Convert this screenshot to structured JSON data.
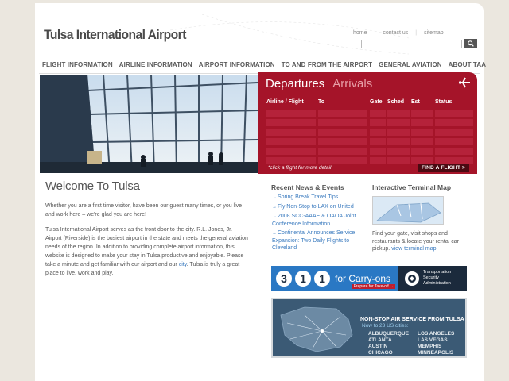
{
  "header": {
    "logo": "Tulsa International Airport",
    "util_links": [
      "home",
      "contact us",
      "sitemap"
    ]
  },
  "nav": {
    "items": [
      "FLIGHT INFORMATION",
      "AIRLINE INFORMATION",
      "AIRPORT INFORMATION",
      "TO AND FROM THE AIRPORT",
      "GENERAL AVIATION",
      "ABOUT TAA"
    ]
  },
  "board": {
    "tab_active": "Departures",
    "tab_inactive": "Arrivals",
    "columns": [
      "Airline / Flight",
      "To",
      "Gate",
      "Sched",
      "Est",
      "Status"
    ],
    "hint": "*click a flight for more detail",
    "find_button": "FIND A FLIGHT >"
  },
  "welcome": {
    "title": "Welcome To Tulsa",
    "para1": "Whether you are a first time visitor, have been our guest many times, or you live and work here – we're glad you are here!",
    "para2_a": "Tulsa International Airport serves as the front door to the city. R.L. Jones, Jr. Airport (Riverside) is the busiest airport in the state and meets the general aviation needs of the region. In addition to providing complete airport information, this website is designed to make your stay in Tulsa productive and enjoyable. Please take a minute and get familiar with our airport and our ",
    "para2_link": "city",
    "para2_b": ". Tulsa is truly a great place to live, work and play."
  },
  "news": {
    "title": "Recent News & Events",
    "items": [
      "Spring Break Travel Tips",
      "Fly Non-Stop to LAX on United",
      "2008 SCC-AAAE & OAOA Joint Conference Information",
      "Continental Announces Service Expansion: Two Daily Flights to Cleveland"
    ]
  },
  "terminal_map": {
    "title": "Interactive Terminal Map",
    "text": "Find your gate, visit shops and restaurants & locate your rental car pickup. ",
    "link": "view terminal map"
  },
  "banner311": {
    "digits": [
      "3",
      "1",
      "1"
    ],
    "carry": "for Carry-ons",
    "prepare": "Prepare for Take-off →",
    "tsa": [
      "Transportation",
      "Security",
      "Administration"
    ]
  },
  "nonstop": {
    "title": "NON-STOP AIR SERVICE FROM TULSA",
    "subtitle": "Now to 23 US cities:",
    "cities": [
      "ALBUQUERQUE",
      "LOS ANGELES",
      "ATLANTA",
      "LAS VEGAS",
      "AUSTIN",
      "MEMPHIS",
      "CHICAGO",
      "MINNEAPOLIS"
    ]
  }
}
